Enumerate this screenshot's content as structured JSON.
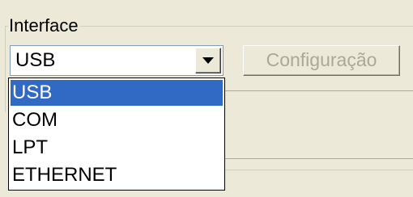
{
  "interface_group": {
    "label": "Interface",
    "combo": {
      "selected_value": "USB",
      "options": [
        "USB",
        "COM",
        "LPT",
        "ETHERNET"
      ],
      "highlighted_option": "USB"
    },
    "config_button_label": "Configuração"
  },
  "colors": {
    "window_bg": "#ece9d8",
    "selection_bg": "#316ac5",
    "disabled_text": "#aca899"
  },
  "icons": {
    "dropdown_arrow": "chevron-down-icon"
  }
}
